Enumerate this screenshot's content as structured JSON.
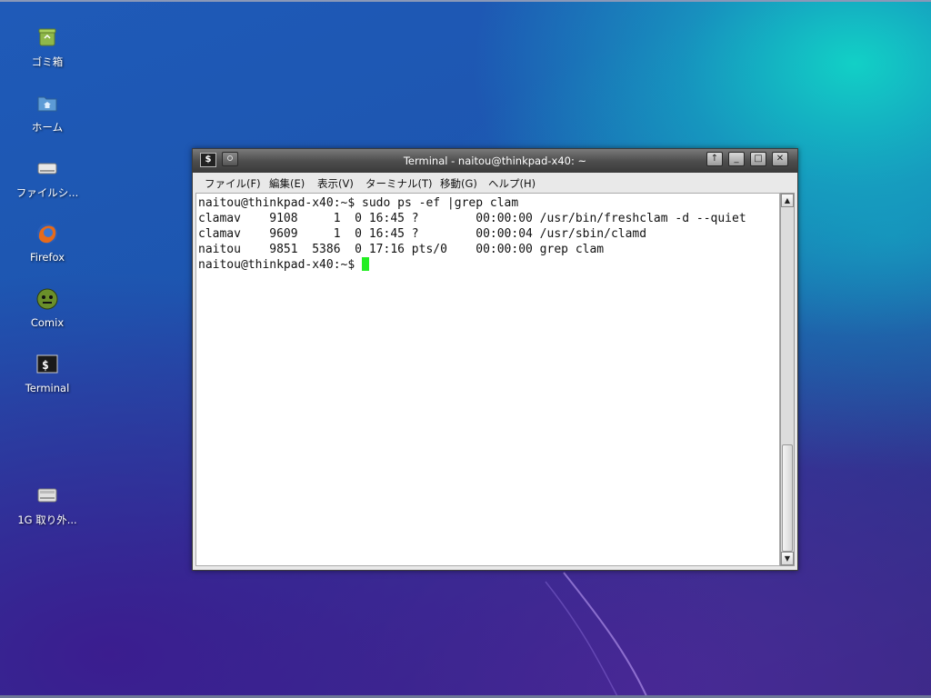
{
  "desktop": {
    "icons": [
      {
        "label": "ゴミ箱",
        "icon": "trash-icon"
      },
      {
        "label": "ホーム",
        "icon": "home-folder-icon"
      },
      {
        "label": "ファイルシ...",
        "icon": "drive-icon"
      },
      {
        "label": "Firefox",
        "icon": "firefox-icon"
      },
      {
        "label": "Comix",
        "icon": "comix-icon"
      },
      {
        "label": "Terminal",
        "icon": "terminal-icon"
      },
      {
        "label": "1G 取り外...",
        "icon": "removable-drive-icon"
      }
    ]
  },
  "window": {
    "title": "Terminal - naitou@thinkpad-x40: ~",
    "app_icon_text": "$",
    "buttons": {
      "shade": "↑",
      "minimize": "_",
      "maximize": "□",
      "close": "✕"
    },
    "menu": [
      "ファイル(F)",
      "編集(E)",
      "表示(V)",
      "ターミナル(T)",
      "移動(G)",
      "ヘルプ(H)"
    ]
  },
  "terminal": {
    "lines": [
      "naitou@thinkpad-x40:~$ sudo ps -ef |grep clam",
      "clamav    9108     1  0 16:45 ?        00:00:00 /usr/bin/freshclam -d --quiet",
      "clamav    9609     1  0 16:45 ?        00:00:04 /usr/sbin/clamd",
      "naitou    9851  5386  0 17:16 pts/0    00:00:00 grep clam"
    ],
    "prompt": "naitou@thinkpad-x40:~$ "
  },
  "scrollbar": {
    "up": "▲",
    "down": "▼"
  },
  "colors": {
    "cursor": "#22ee22"
  }
}
